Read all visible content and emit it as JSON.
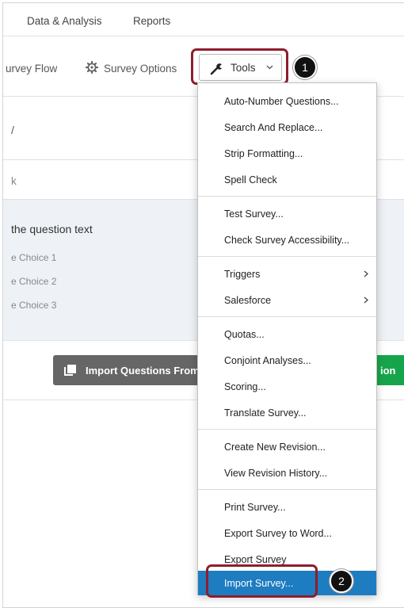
{
  "topnav": {
    "tabs": [
      {
        "label": "Data & Analysis"
      },
      {
        "label": "Reports"
      }
    ]
  },
  "toolbar": {
    "survey_flow_label": "urvey Flow",
    "survey_options_label": "Survey Options",
    "tools_label": "Tools",
    "badge_1": "1"
  },
  "survey": {
    "block_head_text": "/",
    "block_row2_text": "k",
    "question_text": "the question text",
    "choices": [
      "e Choice 1",
      "e Choice 2",
      "e Choice 3"
    ],
    "import_button_label": "Import Questions From",
    "add_button_label": "ion"
  },
  "menu": {
    "items": [
      {
        "label": "Auto-Number Questions..."
      },
      {
        "label": "Search And Replace..."
      },
      {
        "label": "Strip Formatting..."
      },
      {
        "label": "Spell Check"
      },
      {
        "label": "Test Survey..."
      },
      {
        "label": "Check Survey Accessibility..."
      },
      {
        "label": "Triggers"
      },
      {
        "label": "Salesforce"
      },
      {
        "label": "Quotas..."
      },
      {
        "label": "Conjoint Analyses..."
      },
      {
        "label": "Scoring..."
      },
      {
        "label": "Translate Survey..."
      },
      {
        "label": "Create New Revision..."
      },
      {
        "label": "View Revision History..."
      },
      {
        "label": "Print Survey..."
      },
      {
        "label": "Export Survey to Word..."
      },
      {
        "label": "Export Survey"
      },
      {
        "label": "Import Survey..."
      }
    ],
    "badge_2": "2",
    "highlight_color": "#1e7cc0"
  },
  "colors": {
    "callout_outline": "#8f1d2c",
    "green_button": "#17a54b",
    "question_bg": "#eef2f6"
  }
}
